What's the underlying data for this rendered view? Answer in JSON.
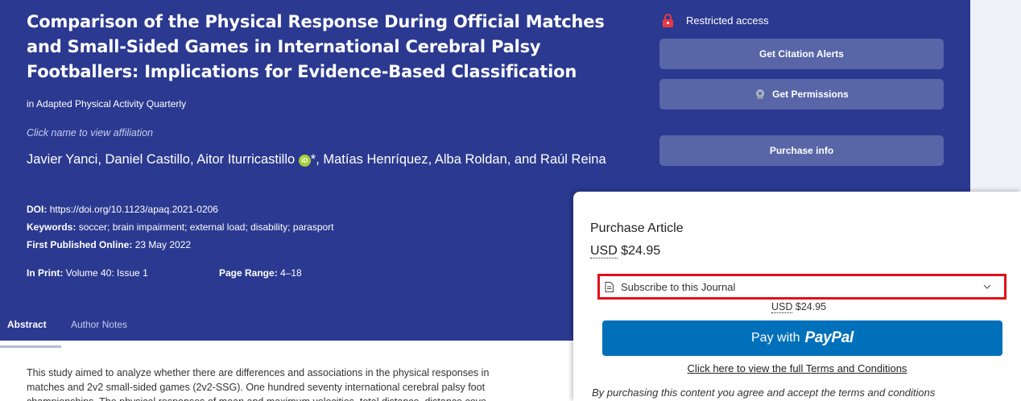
{
  "article": {
    "title": "Comparison of the Physical Response During Official Matches and Small-Sided Games in International Cerebral Palsy Footballers: Implications for Evidence-Based Classification",
    "journal": "in Adapted Physical Activity Quarterly",
    "affiliation_hint": "Click name to view affiliation",
    "authors_part1": "Javier Yanci, Daniel Castillo, Aitor Iturricastillo",
    "orcid_mark": "iD",
    "authors_asterisk": "*",
    "authors_part2": ", Matías Henríquez, Alba Roldan, and Raúl Reina",
    "doi_label": "DOI:",
    "doi_value": "https://doi.org/10.1123/apaq.2021-0206",
    "keywords_label": "Keywords:",
    "keywords_value": "soccer; brain impairment; external load; disability; parasport",
    "published_label": "First Published Online:",
    "published_value": "23 May 2022",
    "print_label": "In Print:",
    "print_value": "Volume 40: Issue 1",
    "range_label": "Page Range:",
    "range_value": "4–18"
  },
  "tabs": {
    "abstract": "Abstract",
    "author_notes": "Author Notes"
  },
  "abstract_lines": [
    "This study aimed to analyze whether there are differences and associations in the physical responses in",
    "matches and 2v2 small-sided games (2v2-SSG). One hundred seventy international cerebral palsy foot",
    "championships. The physical responses of mean and maximum velocities, total distance, distance cove"
  ],
  "sidebar": {
    "access_label": "Restricted access",
    "citation_alerts": "Get Citation Alerts",
    "permissions": "Get Permissions",
    "purchase_info": "Purchase info"
  },
  "purchase": {
    "title": "Purchase Article",
    "currency": "USD",
    "price": "$24.95",
    "option": "Subscribe to this Journal",
    "sub_currency": "USD",
    "sub_price": "$24.95",
    "paypal_prefix": "Pay with",
    "paypal_brand": "PayPal",
    "terms_link": "Click here to view the full Terms and Conditions",
    "terms_note": "By purchasing this content you agree and accept the terms and conditions"
  },
  "colors": {
    "hero_bg": "#2b3990",
    "button_bg": "#5866a8",
    "paypal_blue": "#0070ba",
    "highlight_red": "#e0101c",
    "orcid_green": "#a6ce39"
  }
}
